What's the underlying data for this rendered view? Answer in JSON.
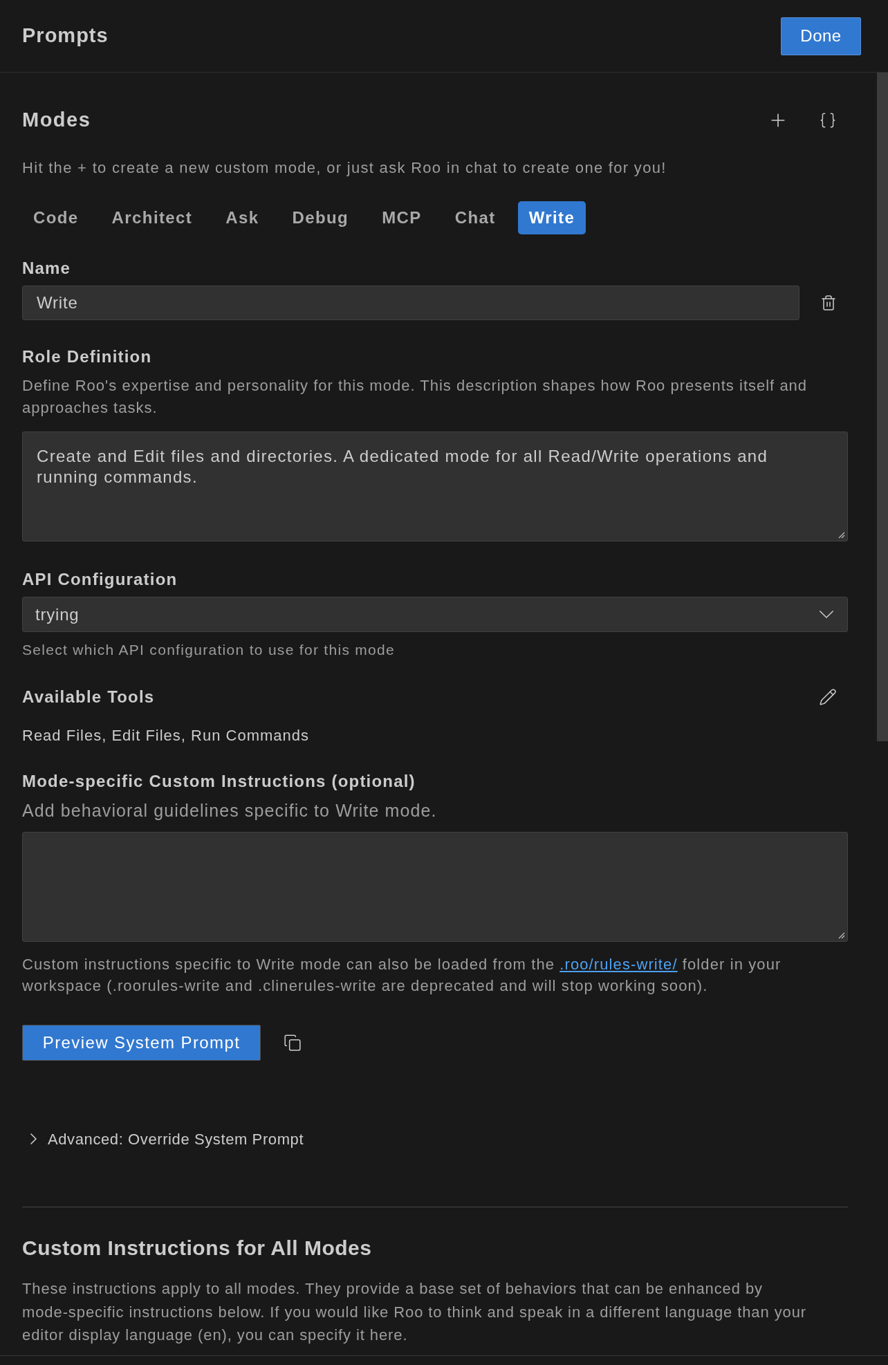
{
  "header": {
    "title": "Prompts",
    "done_button": "Done"
  },
  "modes": {
    "title": "Modes",
    "hint": "Hit the + to create a new custom mode, or just ask Roo in chat to create one for you!",
    "tabs": [
      {
        "label": "Code",
        "selected": false
      },
      {
        "label": "Architect",
        "selected": false
      },
      {
        "label": "Ask",
        "selected": false
      },
      {
        "label": "Debug",
        "selected": false
      },
      {
        "label": "MCP",
        "selected": false
      },
      {
        "label": "Chat",
        "selected": false
      },
      {
        "label": "Write",
        "selected": true
      }
    ]
  },
  "mode_editor": {
    "name": {
      "label": "Name",
      "value": "Write"
    },
    "role_definition": {
      "label": "Role Definition",
      "description": "Define Roo's expertise and personality for this mode. This description shapes how Roo presents itself and approaches tasks.",
      "value": "Create and Edit files and directories. A dedicated mode for all Read/Write operations and running commands."
    },
    "api_configuration": {
      "label": "API Configuration",
      "value": "trying",
      "helper": "Select which API configuration to use for this mode"
    },
    "available_tools": {
      "label": "Available Tools",
      "value": "Read Files, Edit Files, Run Commands"
    },
    "custom_instructions": {
      "label": "Mode-specific Custom Instructions (optional)",
      "description": "Add behavioral guidelines specific to Write mode.",
      "note_before": "Custom instructions specific to Write mode can also be loaded from the ",
      "link": ".roo/rules-write/",
      "note_after": " folder in your workspace (.roorules-write and .clinerules-write are deprecated and will stop working soon)."
    },
    "preview_button": "Preview System Prompt",
    "advanced": {
      "label": "Advanced: Override System Prompt",
      "expanded": false
    }
  },
  "global_instructions": {
    "title": "Custom Instructions for All Modes",
    "description": "These instructions apply to all modes. They provide a base set of behaviors that can be enhanced by mode-specific instructions below. If you would like Roo to think and speak in a different language than your editor display language (en), you can specify it here."
  }
}
